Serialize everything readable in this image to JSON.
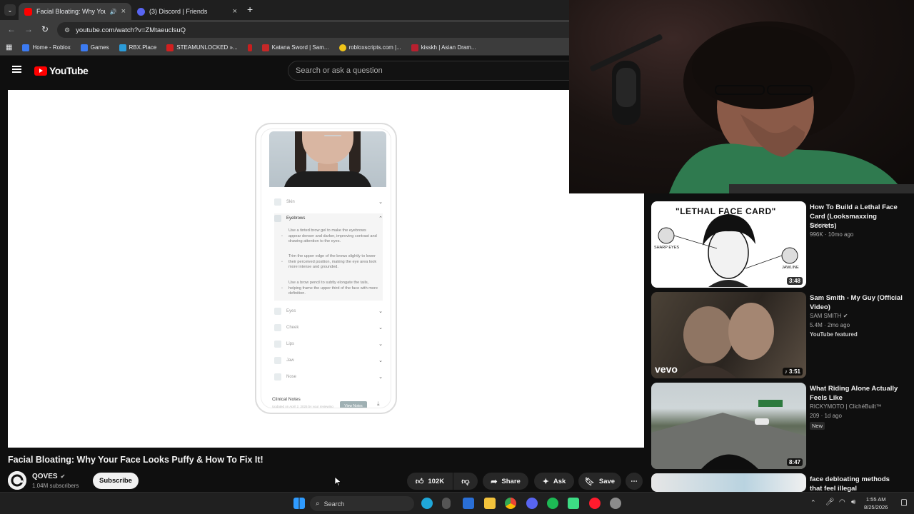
{
  "browser": {
    "tabs": [
      {
        "title": "Facial Bloating: Why Your Fa",
        "active": true
      },
      {
        "title": "(3) Discord | Friends",
        "active": false
      }
    ],
    "url": "youtube.com/watch?v=ZMtaeuclsuQ",
    "bookmarks": [
      "Home - Roblox",
      "Games",
      "RBX.Place",
      "STEAMUNLOCKED »...",
      "Katana Sword | Sam...",
      "robloxscripts.com |...",
      "kisskh | Asian Dram..."
    ]
  },
  "youtube": {
    "logo_text": "YouTube",
    "search_placeholder": "Search or ask a question"
  },
  "phone_ui": {
    "categories_top": [
      "Skin",
      "Eyebrows"
    ],
    "tips": [
      "Use a tinted brow gel to make the eyebrows appear denser and darker, improving contrast and drawing attention to the eyes.",
      "Trim the upper edge of the brows slightly to lower their perceived position, making the eye area look more intense and grounded.",
      "Use a brow pencil to subtly elongate the tails, helping frame the upper third of the face with more definition."
    ],
    "categories_bottom": [
      "Eyes",
      "Cheek",
      "Lips",
      "Jaw",
      "Nose"
    ],
    "clinical_notes": "Clinical Notes",
    "updated": "Updated on April 2, 2025 by your reviewing",
    "view_notes": "View Notes"
  },
  "video": {
    "title": "Facial Bloating: Why Your Face Looks Puffy & How To Fix It!",
    "channel": "QOVES",
    "subscribers": "1.04M subscribers",
    "subscribe_label": "Subscribe",
    "likes": "102K",
    "share_label": "Share",
    "ask_label": "Ask",
    "save_label": "Save"
  },
  "recommendations": [
    {
      "title": "How To Build a Lethal Face Card (Looksmaxxing Secrets)",
      "channel": "Zolven",
      "meta": "996K · 10mo ago",
      "duration": "3:48",
      "thumb_text": "\"LETHAL FACE CARD\"",
      "thumb_left": "SHARP EYES",
      "thumb_right": "JAWLINE"
    },
    {
      "title": "Sam Smith - My Guy (Official Video)",
      "channel": "SAM SMITH",
      "meta": "5.4M · 2mo ago",
      "extra": "YouTube featured",
      "duration": "3:51",
      "thumb_text": "vevo"
    },
    {
      "title": "What Riding Alone Actually Feels Like",
      "channel": "RICKYMOTO | ClichéBuilt™",
      "meta": "209 · 1d ago",
      "badge": "New",
      "duration": "8:47"
    },
    {
      "title": "face debloating methods that feel illegal"
    }
  ],
  "taskbar": {
    "search_label": "Search",
    "time": "1:55 AM",
    "date": "8/25/2026"
  },
  "colors": {
    "yt_red": "#ff0000",
    "background": "#0f0f0f",
    "pill": "#272727"
  }
}
